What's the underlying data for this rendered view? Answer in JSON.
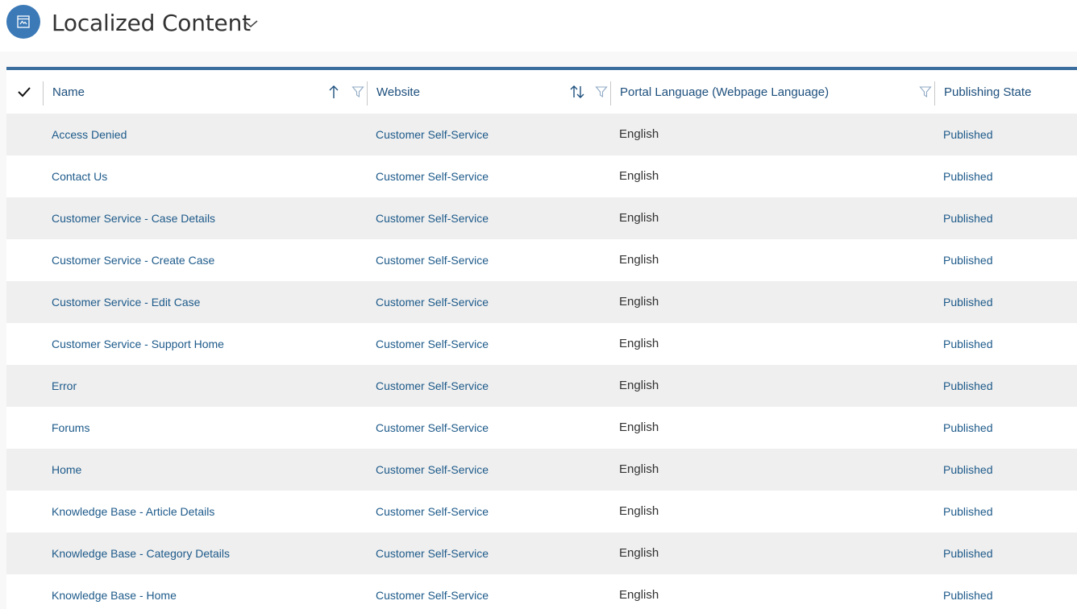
{
  "header": {
    "title": "Localized Content",
    "entity_icon": "webpage-icon",
    "menu_icon": "chevron-down-icon"
  },
  "grid": {
    "select_all_icon": "checkmark-icon",
    "columns": [
      {
        "label": "Name",
        "sort_icon": "sort-ascending-icon",
        "filter_icon": "filter-icon"
      },
      {
        "label": "Website",
        "sort_icon": "sort-updown-icon",
        "filter_icon": "filter-icon"
      },
      {
        "label": "Portal Language (Webpage Language)",
        "filter_icon": "filter-icon"
      },
      {
        "label": "Publishing State"
      }
    ],
    "rows": [
      {
        "name": "Access Denied",
        "website": "Customer Self-Service",
        "language": "English",
        "state": "Published"
      },
      {
        "name": "Contact Us",
        "website": "Customer Self-Service",
        "language": "English",
        "state": "Published"
      },
      {
        "name": "Customer Service - Case Details",
        "website": "Customer Self-Service",
        "language": "English",
        "state": "Published"
      },
      {
        "name": "Customer Service - Create Case",
        "website": "Customer Self-Service",
        "language": "English",
        "state": "Published"
      },
      {
        "name": "Customer Service - Edit Case",
        "website": "Customer Self-Service",
        "language": "English",
        "state": "Published"
      },
      {
        "name": "Customer Service - Support Home",
        "website": "Customer Self-Service",
        "language": "English",
        "state": "Published"
      },
      {
        "name": "Error",
        "website": "Customer Self-Service",
        "language": "English",
        "state": "Published"
      },
      {
        "name": "Forums",
        "website": "Customer Self-Service",
        "language": "English",
        "state": "Published"
      },
      {
        "name": "Home",
        "website": "Customer Self-Service",
        "language": "English",
        "state": "Published"
      },
      {
        "name": "Knowledge Base - Article Details",
        "website": "Customer Self-Service",
        "language": "English",
        "state": "Published"
      },
      {
        "name": "Knowledge Base - Category Details",
        "website": "Customer Self-Service",
        "language": "English",
        "state": "Published"
      },
      {
        "name": "Knowledge Base - Home",
        "website": "Customer Self-Service",
        "language": "English",
        "state": "Published"
      }
    ]
  },
  "colors": {
    "accent": "#3b79b7",
    "grid_top_border": "#3b6e9e",
    "link": "#1d5a8a",
    "header_text": "#1d4f7d",
    "row_alt": "#efefef"
  }
}
